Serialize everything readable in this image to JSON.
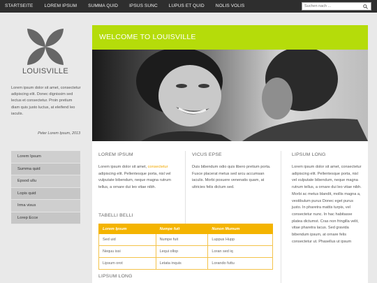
{
  "nav": {
    "items": [
      "STARTSEITE",
      "LOREM IPSUM",
      "SUMMA QUID",
      "IPSUS SUNC",
      "LUPUS ET QUID",
      "NOLIS VOLIS"
    ]
  },
  "search": {
    "placeholder": "Suchen nach ...",
    "icon": "search-icon"
  },
  "sidebar": {
    "brand": "LOUISVILLE",
    "quote": "Lorem ipsum dolor sit amet, consectetur adipiscing elit. Donec dignissim sed lectus et consectetur. Proin pretium diam quis justo luctus, at eleifend leo iaculis.",
    "quote_author": "Peter Lorem Ipsum, 2013",
    "menu": [
      "Lorem Ipsum",
      "Summa quid",
      "Epsod ullu",
      "Lopis quid",
      "Irma visus",
      "Lorep Ecce"
    ]
  },
  "main": {
    "welcome": "WELCOME TO LOUISVILLE",
    "col1": {
      "title": "LOREM IPSUM",
      "text_a": "Lorem ipsum dolor sit amet, ",
      "link": "consectetur",
      "text_b": " adipiscing elit. Pellentesque porta, nisl vel vulputate bibendum, neque magna rutrum tellus, a ornare dui leo vitae nibh."
    },
    "col2": {
      "title": "VICUS EPSE",
      "text": "Duis bibendum odio quis libero pretium porta. Fusce placerat metus sed arcu accumsan iaculis. Morbi posuere venenatis quam, at ultricies felis dictum sed."
    },
    "col3": {
      "title": "LIPSUM LONG",
      "text": "Lorem ipsum dolor sit amet, consectetur adipiscing elit. Pellentesque porta, nisl vel vulputate bibendum, neque magna rutrum tellus, a ornare dui leo vitae nibh. Morbi ac metus blandit, mollis magna a, vestibulum purus Donec eget purus justo. In pharetra mattis turpis, vel consectetur nunc. In hac habitasse platea dictumst. Cras non fringilla velit, vitae pharetra lacus. Sed gravida bibendum ipsum, at ornare felis consectetur ut. Phasellus ut ipsum"
    },
    "table_title": "TABELLI BELLI",
    "table": {
      "headers": [
        "Lorem Ipsum",
        "Numpe fuit",
        "Nunon Mumum"
      ],
      "rows": [
        [
          "Sed uid",
          "Numpe fuit",
          "Luppus Hupp"
        ],
        [
          "Nequu issi",
          "Lequi ollop",
          "Loran sed iq"
        ],
        [
          "Lipsum orot",
          "Letata inquis",
          "Lorando futtu"
        ]
      ]
    },
    "bottom_title": "LIPSUM LONG"
  },
  "colors": {
    "accent_green": "#b5dc0a",
    "accent_orange": "#f4b400",
    "topbar": "#2e2e2e"
  }
}
